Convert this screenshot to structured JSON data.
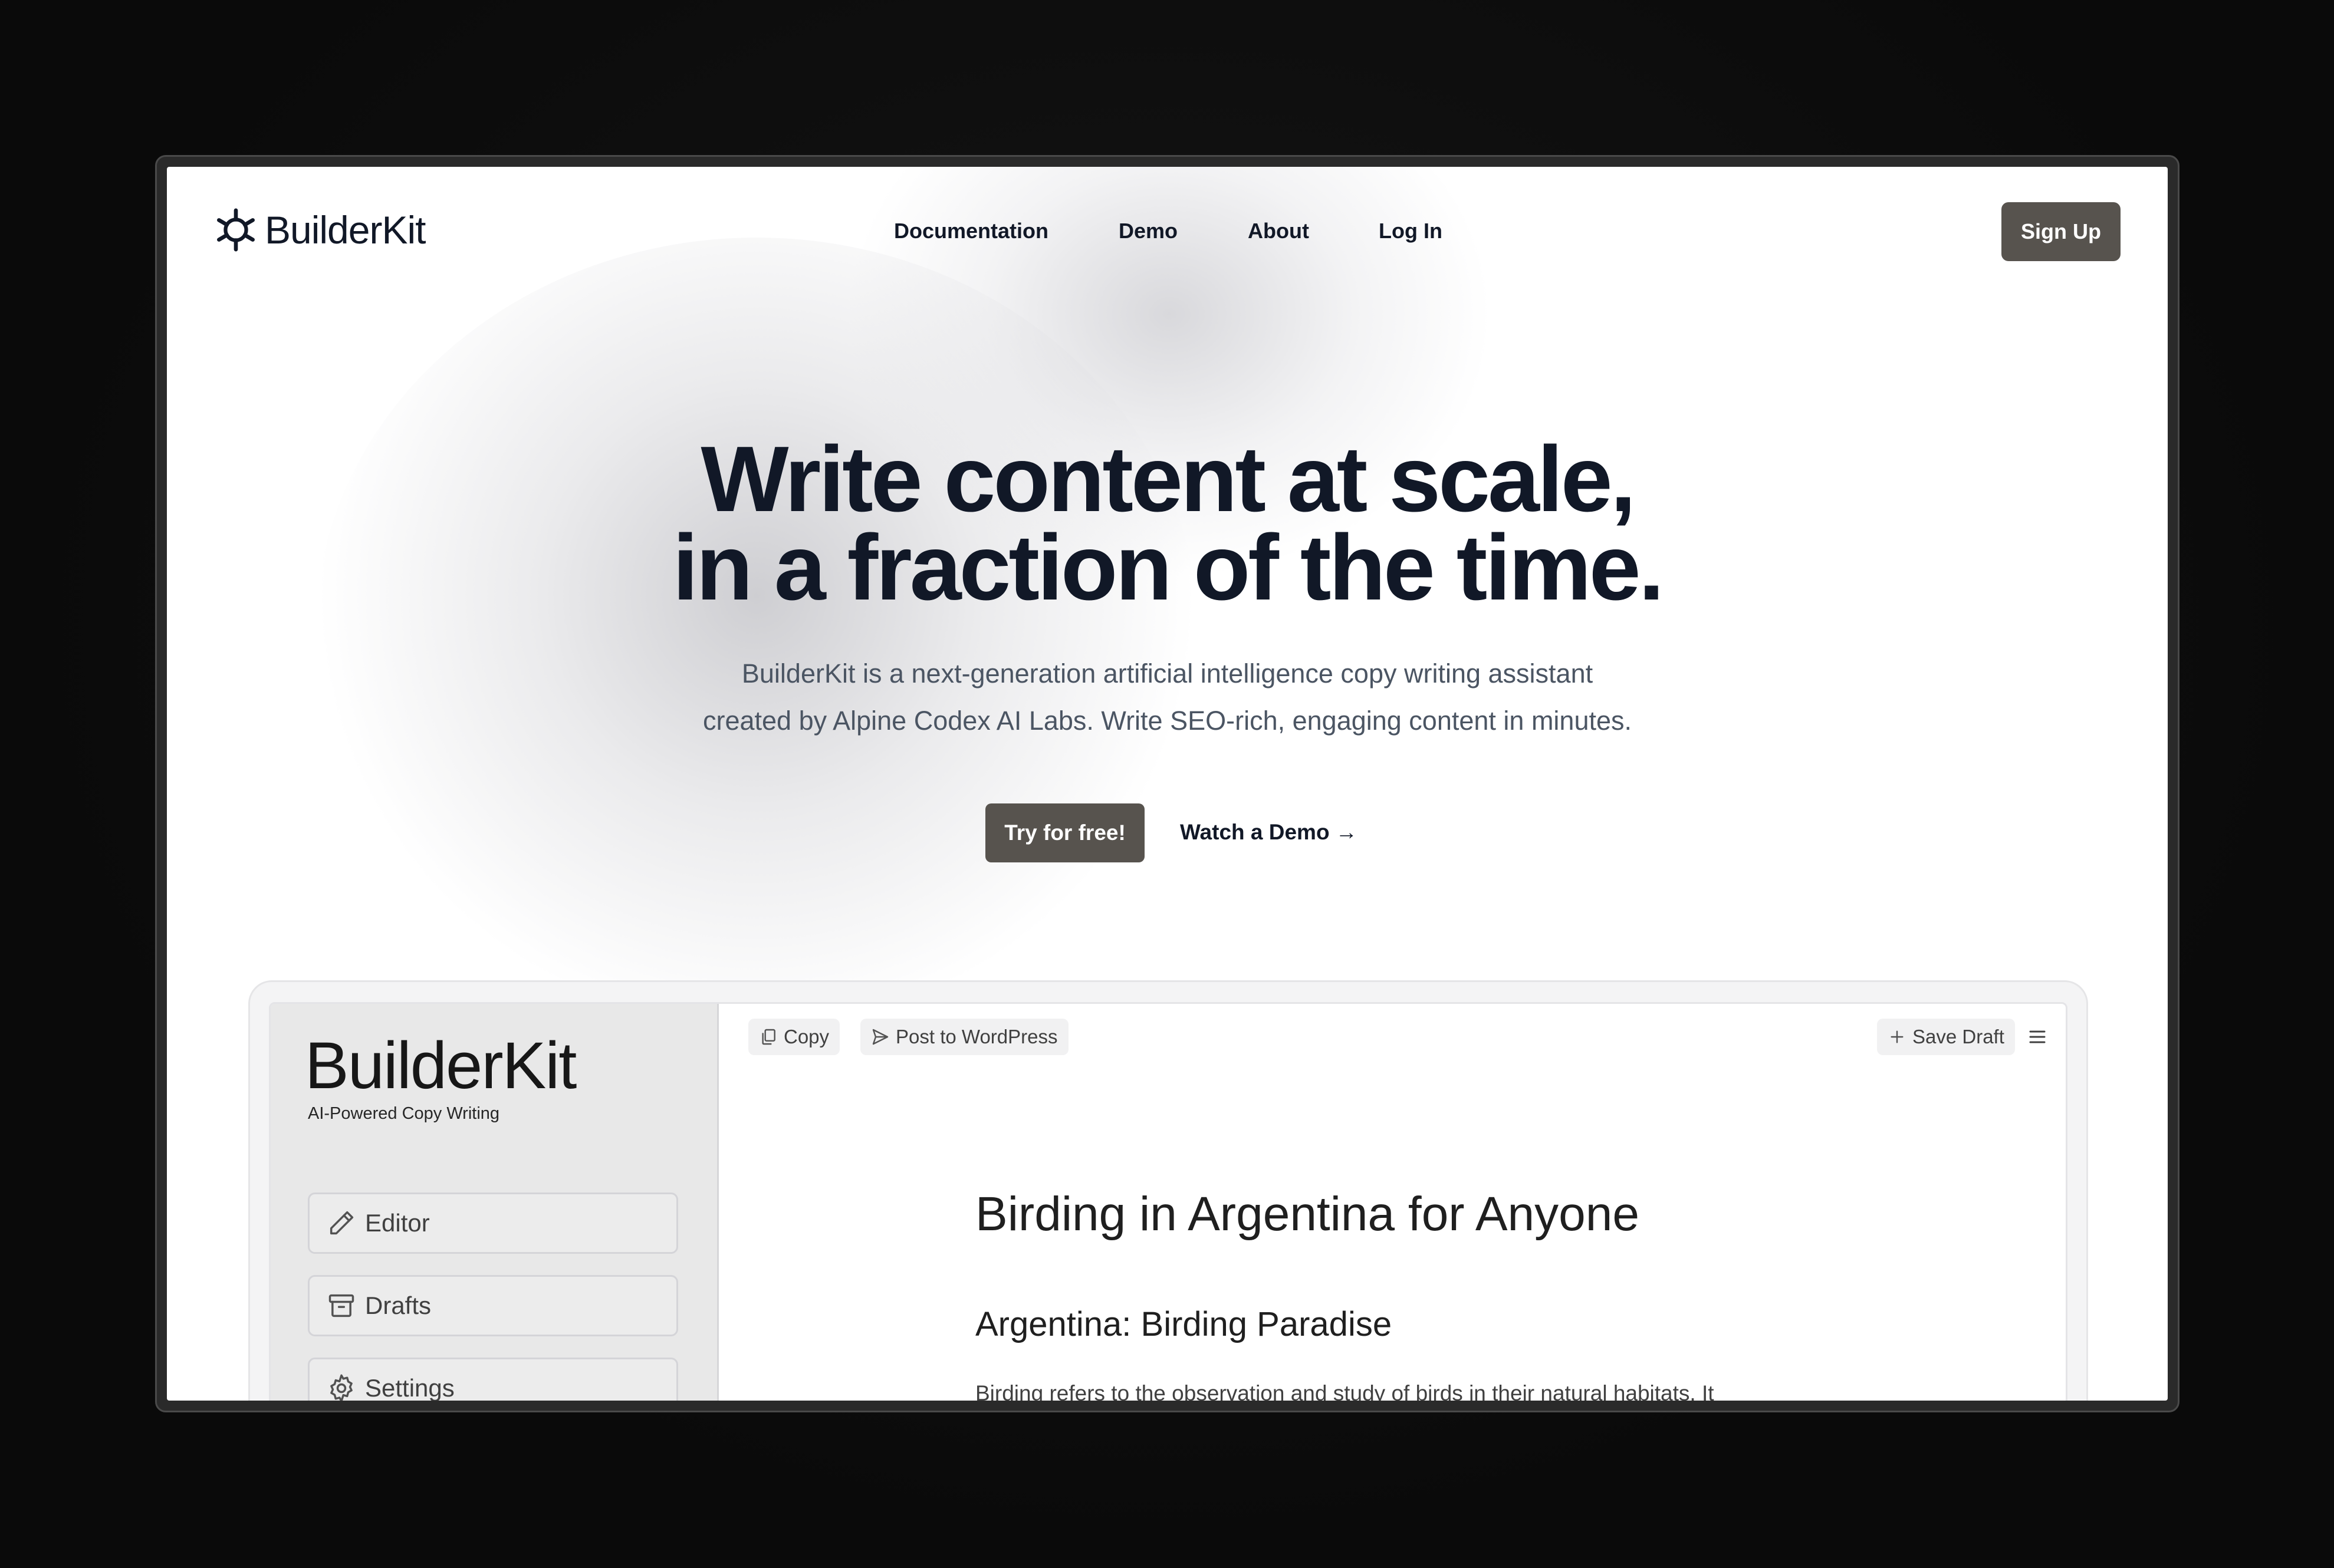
{
  "brand": {
    "name": "BuilderKit"
  },
  "nav": {
    "links": [
      "Documentation",
      "Demo",
      "About",
      "Log In"
    ],
    "signup": "Sign Up"
  },
  "hero": {
    "title_line1": "Write content at scale,",
    "title_line2": "in a fraction of the time.",
    "subtitle_line1": "BuilderKit is a next-generation artificial intelligence copy writing assistant",
    "subtitle_line2": "created by Alpine Codex AI Labs. Write SEO-rich, engaging content in minutes.",
    "cta_primary": "Try for free!",
    "cta_secondary": "Watch a Demo →"
  },
  "app": {
    "brand": "BuilderKit",
    "tagline": "AI-Powered Copy Writing",
    "sidebar": [
      {
        "label": "Editor",
        "icon": "pencil-icon"
      },
      {
        "label": "Drafts",
        "icon": "archive-icon"
      },
      {
        "label": "Settings",
        "icon": "gear-icon"
      }
    ],
    "toolbar": {
      "copy": "Copy",
      "post": "Post to WordPress",
      "save": "Save Draft"
    },
    "doc": {
      "title": "Birding in Argentina for Anyone",
      "heading": "Argentina: Birding Paradise",
      "paragraph": "Birding refers to the observation and study of birds in their natural habitats. It"
    }
  }
}
